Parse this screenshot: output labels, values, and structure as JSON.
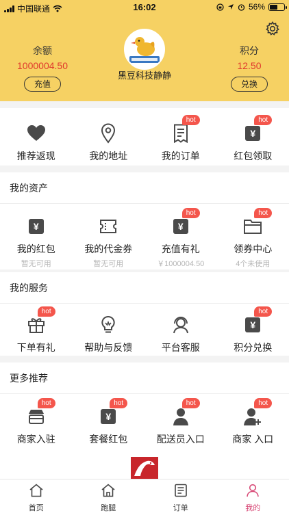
{
  "status_bar": {
    "carrier": "中国联通",
    "time": "16:02",
    "battery": "56%",
    "battery_level": 0.56
  },
  "header": {
    "username": "黑豆科技静静",
    "balance": {
      "label": "余额",
      "value": "1000004.50",
      "button": "充值"
    },
    "points": {
      "label": "积分",
      "value": "12.50",
      "button": "兑换"
    },
    "colors": {
      "background": "#f6d163",
      "accent": "#e0382c"
    }
  },
  "quick": [
    {
      "label": "推荐返现",
      "icon": "heart-icon",
      "hot": ""
    },
    {
      "label": "我的地址",
      "icon": "location-pin-icon",
      "hot": ""
    },
    {
      "label": "我的订单",
      "icon": "order-list-icon",
      "hot": "hot"
    },
    {
      "label": "红包领取",
      "icon": "yen-icon",
      "hot": "hot"
    }
  ],
  "assets": {
    "title": "我的资产",
    "items": [
      {
        "label": "我的红包",
        "sub": "暂无可用",
        "icon": "yen-icon",
        "hot": ""
      },
      {
        "label": "我的代金券",
        "sub": "暂无可用",
        "icon": "ticket-icon",
        "hot": ""
      },
      {
        "label": "充值有礼",
        "sub": "￥1000004.50",
        "icon": "yen-icon",
        "hot": "hot"
      },
      {
        "label": "领券中心",
        "sub": "4个未使用",
        "icon": "folder-icon",
        "hot": "hot"
      }
    ]
  },
  "services": {
    "title": "我的服务",
    "items": [
      {
        "label": "下单有礼",
        "icon": "gift-icon",
        "hot": "hot"
      },
      {
        "label": "帮助与反馈",
        "icon": "lightbulb-icon",
        "hot": ""
      },
      {
        "label": "平台客服",
        "icon": "headset-icon",
        "hot": ""
      },
      {
        "label": "积分兑换",
        "icon": "yen-icon",
        "hot": "hot"
      }
    ]
  },
  "more": {
    "title": "更多推荐",
    "items": [
      {
        "label": "商家入驻",
        "icon": "store-icon",
        "hot": "hot"
      },
      {
        "label": "套餐红包",
        "icon": "yen-icon",
        "hot": "hot"
      },
      {
        "label": "配送员入口",
        "icon": "courier-icon",
        "hot": "hot"
      },
      {
        "label": "商家 入口",
        "icon": "merchant-user-icon",
        "hot": "hot"
      }
    ]
  },
  "tabs": [
    {
      "label": "首页",
      "icon": "home-icon"
    },
    {
      "label": "跑腿",
      "icon": "house-icon"
    },
    {
      "label": "订单",
      "icon": "order-icon"
    },
    {
      "label": "我的",
      "icon": "person-icon",
      "active": true
    }
  ]
}
